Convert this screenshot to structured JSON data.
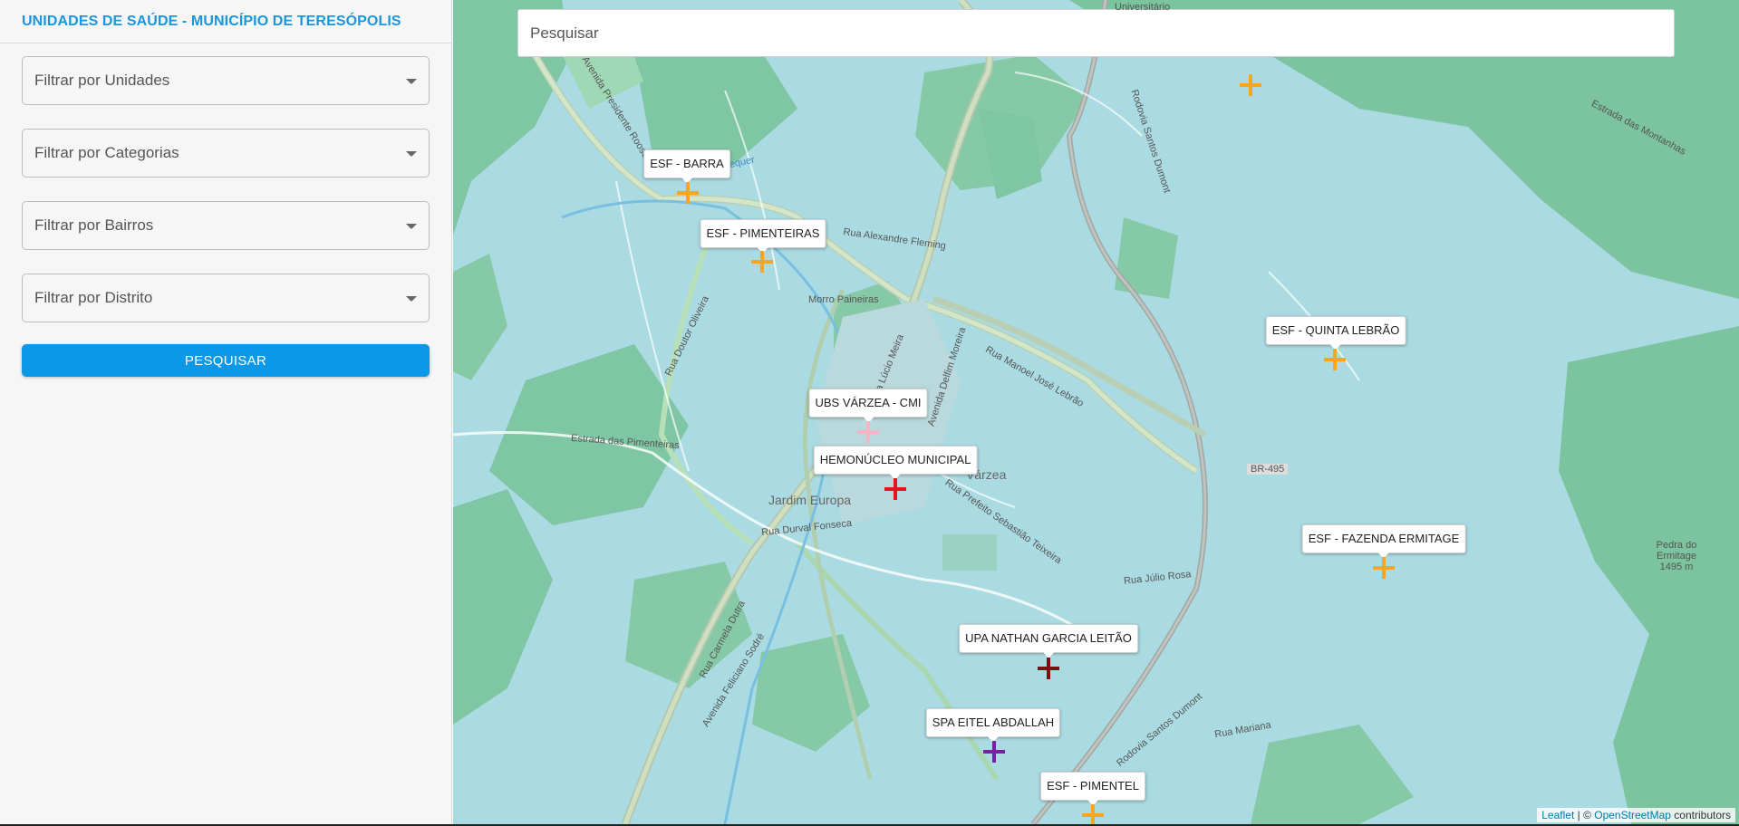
{
  "sidebar": {
    "title": "UNIDADES DE SAÚDE - MUNICÍPIO DE TERESÓPOLIS",
    "filters": [
      {
        "placeholder": "Filtrar por Unidades"
      },
      {
        "placeholder": "Filtrar por Categorias"
      },
      {
        "placeholder": "Filtrar por Bairros"
      },
      {
        "placeholder": "Filtrar por Distrito"
      }
    ],
    "search_button": "PESQUISAR"
  },
  "map": {
    "search_placeholder": "Pesquisar",
    "units": [
      {
        "name": "ESF - BARRA",
        "color": "#f5a623"
      },
      {
        "name": "ESF - PIMENTEIRAS",
        "color": "#f5a623"
      },
      {
        "name": "ESF - QUINTA LEBRÃO",
        "color": "#f5a623"
      },
      {
        "name": "UBS VÁRZEA - CMI",
        "color": "#f4b6c2"
      },
      {
        "name": "HEMONÚCLEO MUNICIPAL",
        "color": "#e3141b"
      },
      {
        "name": "ESF - FAZENDA ERMITAGE",
        "color": "#f5a623"
      },
      {
        "name": "UPA NATHAN GARCIA LEITÃO",
        "color": "#7a1010"
      },
      {
        "name": "SPA EITEL ABDALLAH",
        "color": "#7b1fa2"
      },
      {
        "name": "ESF - PIMENTEL",
        "color": "#f5a623"
      }
    ],
    "place_labels": {
      "rio": "Rio Paquequer",
      "morro": "Morro Paineiras",
      "jardim": "Jardim Europa",
      "varzea": "Várzea",
      "br": "BR-495",
      "pedra": "Pedra do Ermitage 1495 m",
      "av_presidente": "Avenida Presidente Roosevelt",
      "av_delfim": "Avenida Delfim Moreira",
      "av_lucio": "Avenida Lúcio Meira",
      "rua_manoel": "Rua Manoel José Lebrão",
      "rod_santos": "Rodovia Santos Dumont",
      "av_feliciano": "Avenida Feliciano Sodré",
      "rua_carmela": "Rua Carmela Dutra",
      "rua_alexandre": "Rua Alexandre Fleming",
      "estrada_pimenteiras": "Estrada das Pimenteiras",
      "rua_doutor_oliveira": "Rua Doutor Oliveira",
      "estrada_montanhas": "Estrada das Montanhas",
      "rua_durval": "Rua Durval Fonseca",
      "rua_julio": "Rua Júlio Rosa",
      "rua_mariana": "Rua Mariana",
      "universitario": "Universitário",
      "rua_prefeito": "Rua Prefeito Sebastião Teixeira"
    },
    "attribution": {
      "leaflet": "Leaflet",
      "separator": " | © ",
      "osm": "OpenStreetMap",
      "suffix": " contributors"
    }
  }
}
